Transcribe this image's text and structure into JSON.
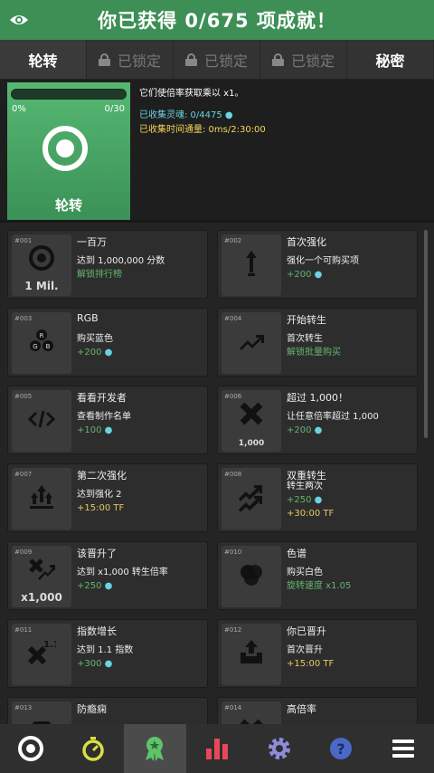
{
  "header": {
    "title": "你已获得 0/675 项成就！",
    "icon": "eye-icon"
  },
  "tabs": [
    {
      "label": "轮转",
      "state": "active"
    },
    {
      "label": "已锁定",
      "state": "locked"
    },
    {
      "label": "已锁定",
      "state": "locked"
    },
    {
      "label": "已锁定",
      "state": "locked"
    },
    {
      "label": "秘密",
      "state": "normal"
    }
  ],
  "selected": {
    "label": "轮转",
    "progress_pct": "0%",
    "progress_count": "0/30",
    "progress_fraction": 0,
    "line1": "它们使倍率获取乘以 x1。",
    "line2": "已收集灵魂: 0/4475",
    "line3": "已收集时间通量: 0ms/2:30:00"
  },
  "achievements": [
    {
      "num": "#001",
      "title": "一百万",
      "desc": "达到 1,000,000 分数",
      "reward": "解锁排行榜",
      "reward_type": "green",
      "icon": "target-icon",
      "sub": "1 Mil."
    },
    {
      "num": "#002",
      "title": "首次强化",
      "desc": "强化一个可购买项",
      "reward": "+200",
      "reward_type": "blue",
      "icon": "arrow-up-icon",
      "sub": ""
    },
    {
      "num": "#003",
      "title": "RGB",
      "desc": "购买蓝色",
      "reward": "+200",
      "reward_type": "blue",
      "icon": "rgb-icon",
      "sub": ""
    },
    {
      "num": "#004",
      "title": "开始转生",
      "desc": "首次转生",
      "reward": "解锁批量购买",
      "reward_type": "green",
      "icon": "trending-up-icon",
      "sub": ""
    },
    {
      "num": "#005",
      "title": "看看开发者",
      "desc": "查看制作名单",
      "reward": "+100",
      "reward_type": "blue",
      "icon": "code-icon",
      "sub": ""
    },
    {
      "num": "#006",
      "title": "超过 1,000！",
      "desc": "让任意倍率超过 1,000",
      "reward": "+200",
      "reward_type": "blue",
      "icon": "times-icon",
      "sub": "1,000"
    },
    {
      "num": "#007",
      "title": "第二次强化",
      "desc": "达到强化 2",
      "reward": "+15:00 TF",
      "reward_type": "yellow",
      "icon": "double-arrow-up-icon",
      "sub": ""
    },
    {
      "num": "#008",
      "title": "双重转生",
      "desc": "转生两次",
      "reward": "+250",
      "reward_type": "blue",
      "reward2": "+30:00 TF",
      "icon": "double-trending-icon",
      "sub": ""
    },
    {
      "num": "#009",
      "title": "该晋升了",
      "desc": "达到 x1,000 转生倍率",
      "reward": "+250",
      "reward_type": "blue",
      "icon": "times-trend-icon",
      "sub": "x1,000"
    },
    {
      "num": "#010",
      "title": "色谱",
      "desc": "购买白色",
      "reward": "旋转速度 x1.05",
      "reward_type": "green",
      "icon": "circles-icon",
      "sub": ""
    },
    {
      "num": "#011",
      "title": "指数增长",
      "desc": "达到 1.1 指数",
      "reward": "+300",
      "reward_type": "blue",
      "icon": "exponent-icon",
      "sub": ""
    },
    {
      "num": "#012",
      "title": "你已晋升",
      "desc": "首次晋升",
      "reward": "+15:00 TF",
      "reward_type": "yellow",
      "icon": "box-up-icon",
      "sub": ""
    },
    {
      "num": "#013",
      "title": "防瘾痫",
      "desc": "",
      "reward": "",
      "reward_type": "",
      "icon": "unknown-icon",
      "sub": ""
    },
    {
      "num": "#014",
      "title": "高倍率",
      "desc": "",
      "reward": "",
      "reward_type": "",
      "icon": "times-icon",
      "sub": ""
    }
  ],
  "nav": [
    {
      "name": "spin-icon",
      "active": false
    },
    {
      "name": "stopwatch-icon",
      "active": false
    },
    {
      "name": "achievement-ribbon-icon",
      "active": true
    },
    {
      "name": "stats-chart-icon",
      "active": false
    },
    {
      "name": "settings-gear-icon",
      "active": false
    },
    {
      "name": "help-question-icon",
      "active": false
    },
    {
      "name": "menu-icon",
      "active": false
    }
  ],
  "colors": {
    "accent_green": "#3d8f56",
    "soul_blue": "#6ad3e0",
    "tf_yellow": "#e5c765"
  }
}
